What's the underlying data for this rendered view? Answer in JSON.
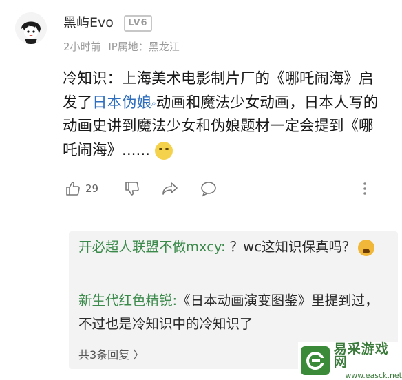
{
  "post": {
    "username": "黑屿Evo",
    "level": "LV6",
    "time": "2小时前",
    "ip_location": "IP属地：黑龙江",
    "text_before_link": "冷知识：上海美术电影制片厂的《哪吒闹海》启发了",
    "link_text": "日本伪娘",
    "text_after_link": "动画和魔法少女动画，日本人写的动画史讲到魔法少女和伪娘题材一定会提到《哪吒闹海》......",
    "like_count": "29"
  },
  "replies": [
    {
      "nick": "开必超人联盟不做mxcy:",
      "text": " ？wc这知识保真吗？"
    },
    {
      "nick": "新生代红色精锐:",
      "text": "《日本动画演变图鉴》里提到过，不过也是冷知识中的冷知识了"
    }
  ],
  "more_replies": "共3条回复 〉",
  "watermark": {
    "name": "易采游戏网",
    "url": "www.easck.net"
  },
  "colors": {
    "nick": "#3b8a4b",
    "link": "#2f6fbd",
    "reply_bg": "#f3f3f3"
  }
}
